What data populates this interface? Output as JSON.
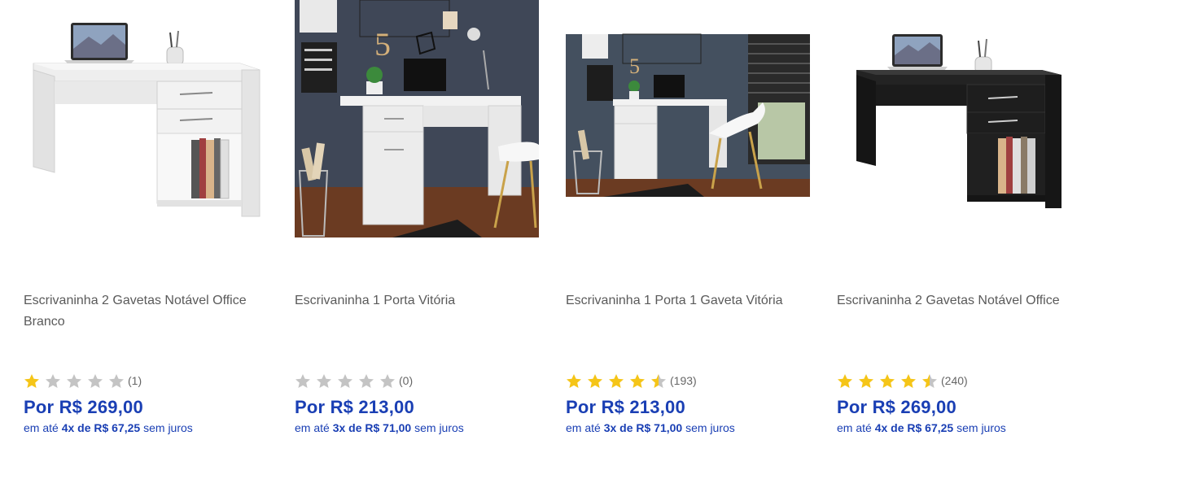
{
  "colors": {
    "price": "#1a3fb4",
    "star_filled": "#f5c518",
    "star_empty": "#c4c4c4"
  },
  "products": [
    {
      "image_icon": "white-desk-2-drawers-photo",
      "title": "Escrivaninha 2 Gavetas Notável Office Branco",
      "rating": 1,
      "review_count": "(1)",
      "price": "Por R$ 269,00",
      "install_prefix": "em até",
      "install_qty": "4x de R$ 67,25",
      "install_suffix": "sem juros"
    },
    {
      "image_icon": "white-desk-room-photo",
      "title": "Escrivaninha 1 Porta Vitória",
      "rating": 0,
      "review_count": "(0)",
      "price": "Por R$ 213,00",
      "install_prefix": "em até",
      "install_qty": "3x de R$ 71,00",
      "install_suffix": "sem juros"
    },
    {
      "image_icon": "white-desk-room-wide-photo",
      "title": "Escrivaninha 1 Porta 1 Gaveta Vitória",
      "rating": 4.5,
      "review_count": "(193)",
      "price": "Por R$ 213,00",
      "install_prefix": "em até",
      "install_qty": "3x de R$ 71,00",
      "install_suffix": "sem juros"
    },
    {
      "image_icon": "black-desk-2-drawers-photo",
      "title": "Escrivaninha 2 Gavetas Notável Office",
      "rating": 4.5,
      "review_count": "(240)",
      "price": "Por R$ 269,00",
      "install_prefix": "em até",
      "install_qty": "4x de R$ 67,25",
      "install_suffix": "sem juros"
    }
  ]
}
